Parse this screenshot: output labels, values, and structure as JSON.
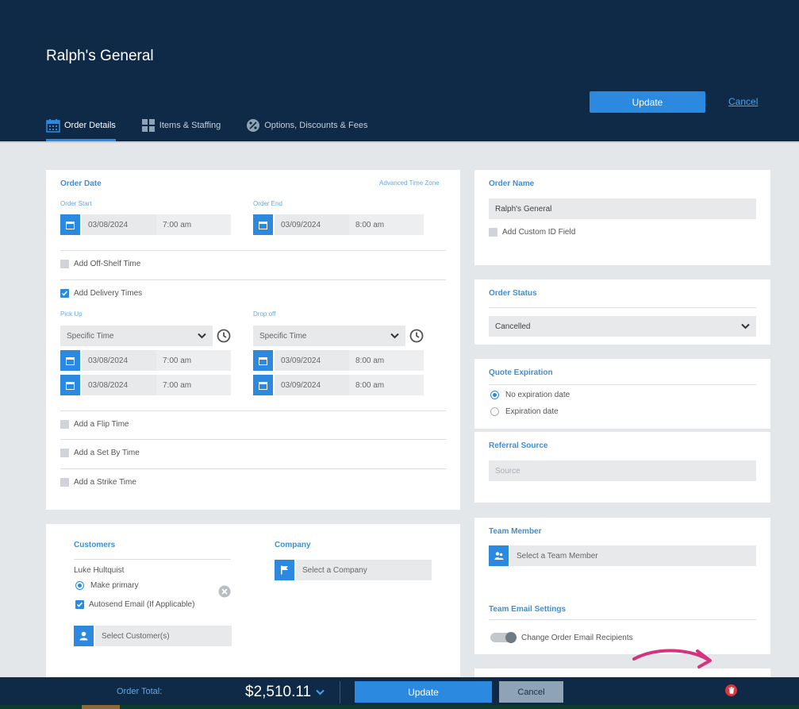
{
  "header": {
    "title": "Ralph's General",
    "update_label": "Update",
    "cancel_label": "Cancel",
    "tabs": [
      {
        "label": "Order Details",
        "icon": "calendar-icon",
        "active": true
      },
      {
        "label": "Items & Staffing",
        "icon": "grid-icon",
        "active": false
      },
      {
        "label": "Options, Discounts & Fees",
        "icon": "percent-badge-icon",
        "active": false
      }
    ]
  },
  "order_date": {
    "heading": "Order Date",
    "advanced_tz": "Advanced Time Zone",
    "start_label": "Order Start",
    "start_date": "03/08/2024",
    "start_time": "7:00 am",
    "end_label": "Order End",
    "end_date": "03/09/2024",
    "end_time": "8:00 am",
    "off_shelf": "Add Off-Shelf Time",
    "delivery": "Add Delivery Times",
    "pickup_label": "Pick Up",
    "pickup_mode": "Specific Time",
    "pickup_date1": "03/08/2024",
    "pickup_time1": "7:00 am",
    "pickup_date2": "03/08/2024",
    "pickup_time2": "7:00 am",
    "dropoff_label": "Drop off",
    "dropoff_mode": "Specific Time",
    "dropoff_date1": "03/09/2024",
    "dropoff_time1": "8:00 am",
    "dropoff_date2": "03/09/2024",
    "dropoff_time2": "8:00 am",
    "flip": "Add a Flip Time",
    "setby": "Add a Set By Time",
    "strike": "Add a Strike Time"
  },
  "customers": {
    "heading": "Customers",
    "name": "Luke Hultquist",
    "make_primary": "Make primary",
    "autosend": "Autosend Email (If Applicable)",
    "select_customer": "Select Customer(s)",
    "company_heading": "Company",
    "select_company": "Select a Company"
  },
  "order_name": {
    "heading": "Order Name",
    "value": "Ralph's General",
    "custom_id": "Add Custom ID Field"
  },
  "order_status": {
    "heading": "Order Status",
    "value": "Cancelled"
  },
  "quote": {
    "heading": "Quote Expiration",
    "opt1": "No expiration date",
    "opt2": "Expiration date"
  },
  "referral": {
    "heading": "Referral Source",
    "placeholder": "Source"
  },
  "team": {
    "heading": "Team Member",
    "select": "Select a Team Member",
    "email_heading": "Team Email Settings",
    "email_toggle": "Change Order Email Recipients"
  },
  "footer": {
    "total_label": "Order Total:",
    "total_value": "$2,510.11",
    "update_label": "Update",
    "cancel_label": "Cancel"
  },
  "colors": {
    "header_bg": "#0f2a47",
    "accent": "#2b8ae0",
    "annotation_arrow": "#d6337f",
    "danger": "#d9363e"
  }
}
